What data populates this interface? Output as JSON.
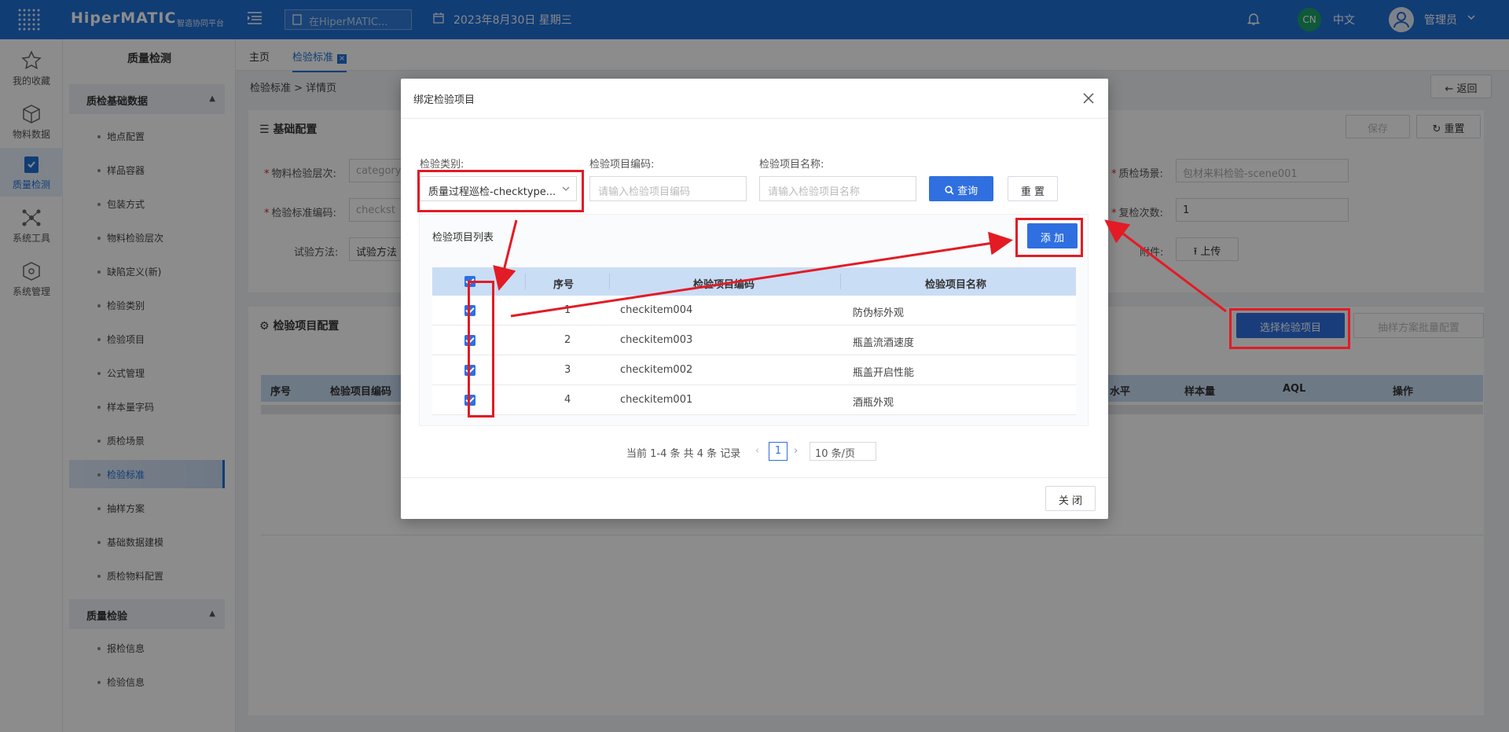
{
  "header": {
    "logo": "HiperMATIC",
    "logo_sub": "智造协同平台",
    "search_placeholder": "在HiperMATIC...",
    "date": "2023年8月30日 星期三",
    "lang_badge": "CN",
    "lang": "中文",
    "user": "管理员"
  },
  "rail": [
    {
      "label": "我的收藏",
      "icon": "star-icon"
    },
    {
      "label": "物料数据",
      "icon": "cube-icon"
    },
    {
      "label": "质量检测",
      "icon": "quality-icon"
    },
    {
      "label": "系统工具",
      "icon": "network-icon"
    },
    {
      "label": "系统管理",
      "icon": "box-icon"
    }
  ],
  "subnav": {
    "title": "质量检测",
    "group1": "质检基础数据",
    "items1": [
      "地点配置",
      "样品容器",
      "包装方式",
      "物料检验层次",
      "缺陷定义(新)",
      "检验类别",
      "检验项目",
      "公式管理",
      "样本量字码",
      "质检场景",
      "检验标准",
      "抽样方案",
      "基础数据建模",
      "质检物料配置"
    ],
    "group2": "质量检验",
    "items2": [
      "报检信息",
      "检验信息"
    ]
  },
  "tabs": [
    "主页",
    "检验标准"
  ],
  "breadcrumb": "检验标准 > 详情页",
  "back_btn": "返回",
  "basic": {
    "title": "基础配置",
    "save": "保存",
    "reset": "重置",
    "f1_label": "物料检验层次:",
    "f1_value": "category",
    "f2_label": "检验标准编码:",
    "f2_value": "checkst",
    "f3_label": "试验方法:",
    "f3_value": "试验方法",
    "f4_label": "质检场景:",
    "f4_value": "包材来料检验-scene001",
    "f5_label": "复检次数:",
    "f5_value": "1",
    "f6_label": "附件:",
    "upload": "上传"
  },
  "items_cfg": {
    "title": "检验项目配置",
    "select_btn": "选择检验项目",
    "batch_btn": "抽样方案批量配置",
    "columns": [
      "序号",
      "检验项目编码",
      "水平",
      "样本量",
      "AQL",
      "操作"
    ]
  },
  "modal": {
    "title": "绑定检验项目",
    "category_label": "检验类别:",
    "category_value": "质量过程巡检-checktype...",
    "code_label": "检验项目编码:",
    "code_placeholder": "请输入检验项目编码",
    "name_label": "检验项目名称:",
    "name_placeholder": "请输入检验项目名称",
    "query": "查询",
    "reset": "重 置",
    "list_title": "检验项目列表",
    "add": "添 加",
    "columns": [
      "序号",
      "检验项目编码",
      "检验项目名称"
    ],
    "rows": [
      {
        "no": "1",
        "code": "checkitem004",
        "name": "防伪标外观"
      },
      {
        "no": "2",
        "code": "checkitem003",
        "name": "瓶盖流酒速度"
      },
      {
        "no": "3",
        "code": "checkitem002",
        "name": "瓶盖开启性能"
      },
      {
        "no": "4",
        "code": "checkitem001",
        "name": "酒瓶外观"
      }
    ],
    "pager_text": "当前 1-4 条 共 4 条 记录",
    "page": "1",
    "page_size": "10 条/页",
    "close": "关 闭"
  },
  "colors": {
    "primary": "#1f6fd6",
    "button": "#2f6fe0",
    "annotation": "#e21b25"
  }
}
